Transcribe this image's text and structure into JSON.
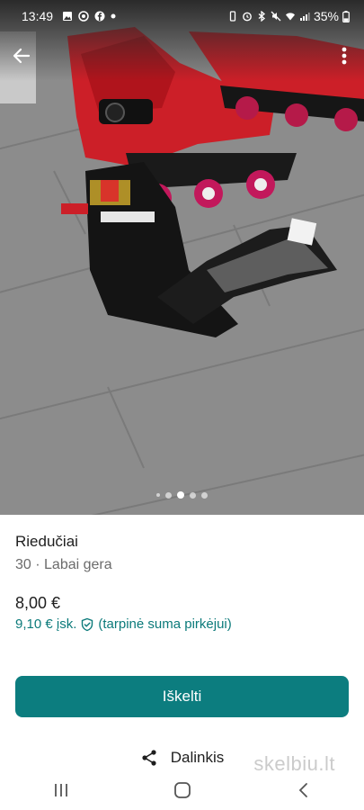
{
  "status_bar": {
    "time": "13:49",
    "battery": "35%"
  },
  "header": {
    "back_icon": "arrow-left-icon",
    "more_icon": "more-vert-icon"
  },
  "carousel": {
    "dot_count": 5,
    "active_index": 2
  },
  "listing": {
    "title": "Riedučiai",
    "subtitle": "30 · Labai gera",
    "price": "8,00 €",
    "buyer_price": "9,10 €  įsk.",
    "buyer_note": "(tarpinė suma pirkėjui)"
  },
  "actions": {
    "primary_label": "Iškelti",
    "share_label": "Dalinkis"
  },
  "watermark": "skelbiu.lt",
  "colors": {
    "accent": "#0c7d7f",
    "buyer_price": "#0b7a7a"
  }
}
